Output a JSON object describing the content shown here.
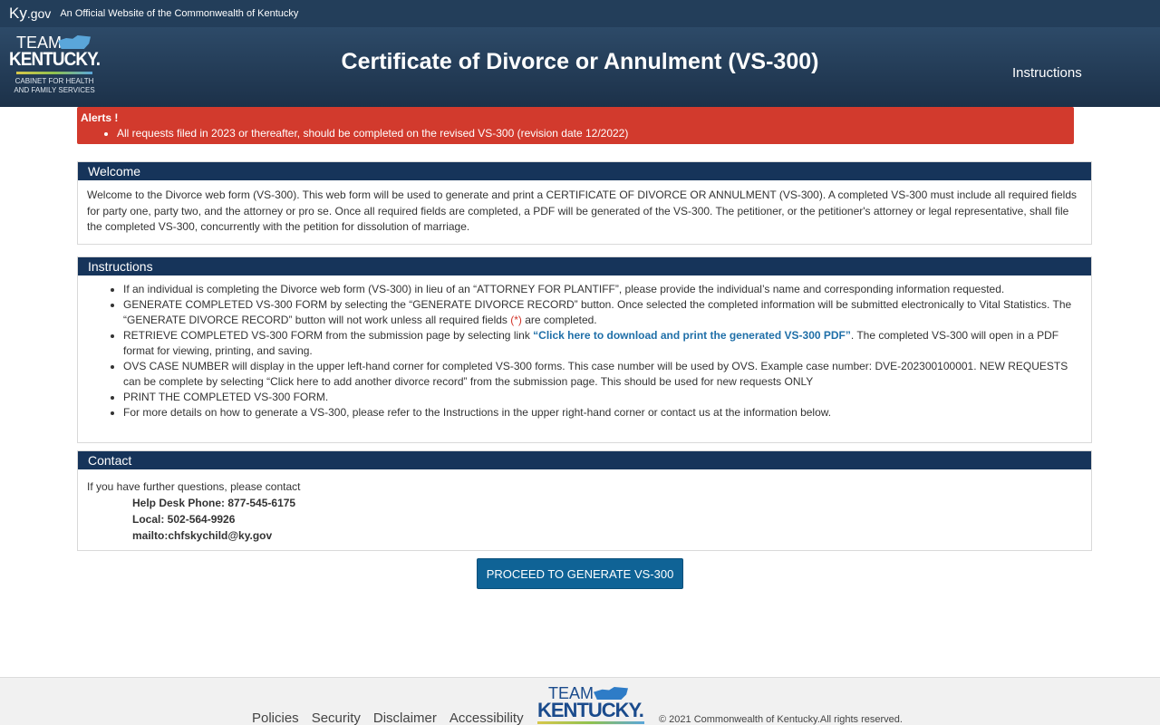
{
  "topbar": {
    "site_name_main": "Ky",
    "site_name_suffix": ".gov",
    "official_text": "An Official Website of the Commonwealth of Kentucky"
  },
  "header": {
    "logo_team": "TEAM",
    "logo_kentucky": "KENTUCKY.",
    "logo_cabinet_line1": "CABINET FOR HEALTH",
    "logo_cabinet_line2": "AND FAMILY SERVICES",
    "title": "Certificate of Divorce or Annulment (VS-300)",
    "instructions_link": "Instructions"
  },
  "alert": {
    "title": "Alerts !",
    "items": [
      "All requests filed in 2023 or thereafter, should be completed on the revised VS-300 (revision date 12/2022)"
    ]
  },
  "welcome": {
    "heading": "Welcome",
    "body": "Welcome to the Divorce web form (VS-300). This web form will be used to generate and print a CERTIFICATE OF DIVORCE OR ANNULMENT (VS-300). A completed VS-300 must include all required fields for party one, party two, and the attorney or pro se. Once all required fields are completed, a PDF will be generated of the VS-300. The petitioner, or the petitioner's attorney or legal representative, shall file the completed VS-300, concurrently with the petition for dissolution of marriage."
  },
  "instructions": {
    "heading": "Instructions",
    "item1": "If an individual is completing the Divorce web form (VS-300) in lieu of an “ATTORNEY FOR PLANTIFF”, please provide the individual’s name and corresponding information requested.",
    "item2_a": "GENERATE COMPLETED VS-300 FORM by selecting the “GENERATE DIVORCE RECORD” button. Once selected the completed information will be submitted electronically to Vital Statistics. The “GENERATE DIVORCE RECORD” button will not work unless all required fields ",
    "item2_req": "(*)",
    "item2_b": " are completed.",
    "item3_a": "RETRIEVE COMPLETED VS-300 FORM from the submission page by selecting link ",
    "item3_link": "“Click here to download and print the generated VS-300 PDF”",
    "item3_b": ". The completed VS-300 will open in a PDF format for viewing, printing, and saving.",
    "item4": "OVS CASE NUMBER will display in the upper left-hand corner for completed VS-300 forms. This case number will be used by OVS. Example case number: DVE-202300100001. NEW REQUESTS can be complete by selecting “Click here to add another divorce record” from the submission page. This should be used for new requests ONLY",
    "item5": "PRINT THE COMPLETED VS-300 FORM.",
    "item6": "For more details on how to generate a VS-300, please refer to the Instructions in the upper right-hand corner or contact us at the information below."
  },
  "contact": {
    "heading": "Contact",
    "intro": "If you have further questions, please contact",
    "phone": "Help Desk Phone: 877-545-6175",
    "local": "Local: 502-564-9926",
    "email": "mailto:chfskychild@ky.gov"
  },
  "proceed_button": "PROCEED TO GENERATE VS-300",
  "footer": {
    "links": [
      "Policies",
      "Security",
      "Disclaimer",
      "Accessibility"
    ],
    "logo_team": "TEAM",
    "logo_kentucky": "KENTUCKY.",
    "copyright": "© 2021 Commonwealth of Kentucky.All rights reserved."
  }
}
